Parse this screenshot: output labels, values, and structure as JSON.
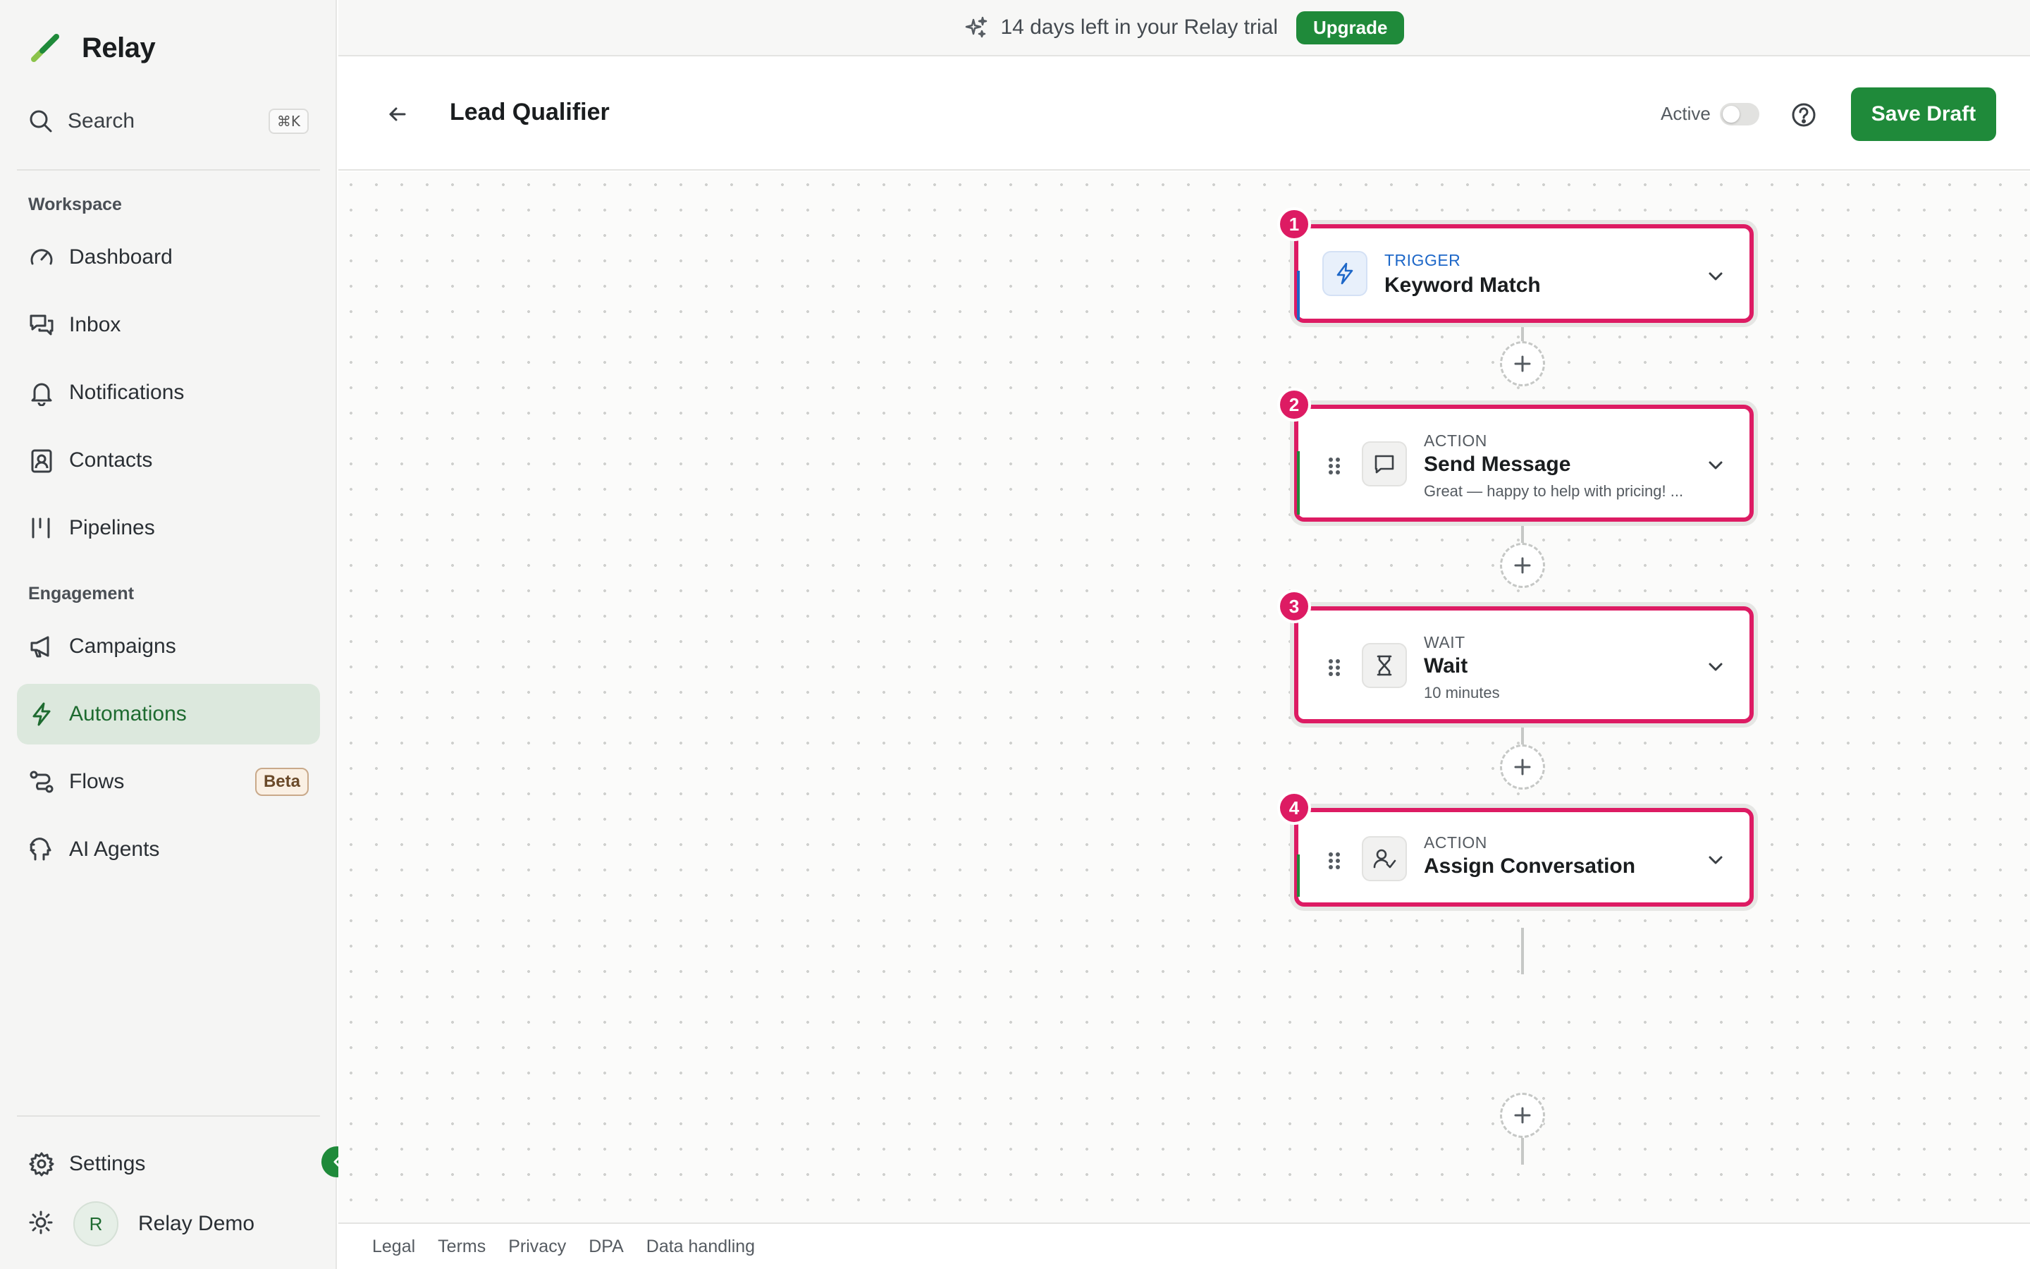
{
  "app": {
    "name": "Relay",
    "colors": {
      "brand": "#1f8a3a",
      "accent": "#dd1b63",
      "trigger": "#1d67c8"
    }
  },
  "sidebar": {
    "search": {
      "label": "Search",
      "shortcut": "⌘K"
    },
    "sections": [
      {
        "label": "Workspace"
      },
      {
        "label": "Engagement"
      }
    ],
    "items": [
      {
        "label": "Dashboard",
        "icon": "gauge-icon"
      },
      {
        "label": "Inbox",
        "icon": "chat-bubbles-icon"
      },
      {
        "label": "Notifications",
        "icon": "bell-icon"
      },
      {
        "label": "Contacts",
        "icon": "contact-card-icon"
      },
      {
        "label": "Pipelines",
        "icon": "pipeline-icon"
      },
      {
        "label": "Campaigns",
        "icon": "megaphone-icon"
      },
      {
        "label": "Automations",
        "icon": "lightning-icon",
        "active": true
      },
      {
        "label": "Flows",
        "icon": "flow-icon",
        "badge": "Beta"
      },
      {
        "label": "AI Agents",
        "icon": "agent-icon"
      }
    ],
    "settings": {
      "label": "Settings"
    },
    "user": {
      "initial": "R",
      "name": "Relay Demo"
    }
  },
  "banner": {
    "text": "14 days left in your Relay trial",
    "upgrade_label": "Upgrade"
  },
  "header": {
    "title": "Lead Qualifier",
    "active_label": "Active",
    "active": false,
    "save_label": "Save Draft"
  },
  "workflow": {
    "steps": [
      {
        "number": "1",
        "kind": "TRIGGER",
        "name": "Keyword Match",
        "detail": "",
        "icon": "lightning-icon"
      },
      {
        "number": "2",
        "kind": "ACTION",
        "name": "Send Message",
        "detail": "Great — happy to help with pricing! ...",
        "icon": "message-icon"
      },
      {
        "number": "3",
        "kind": "WAIT",
        "name": "Wait",
        "detail": "10 minutes",
        "icon": "hourglass-icon"
      },
      {
        "number": "4",
        "kind": "ACTION",
        "name": "Assign Conversation",
        "detail": "",
        "icon": "user-assign-icon"
      }
    ]
  },
  "footer": {
    "links": [
      "Legal",
      "Terms",
      "Privacy",
      "DPA",
      "Data handling"
    ]
  }
}
